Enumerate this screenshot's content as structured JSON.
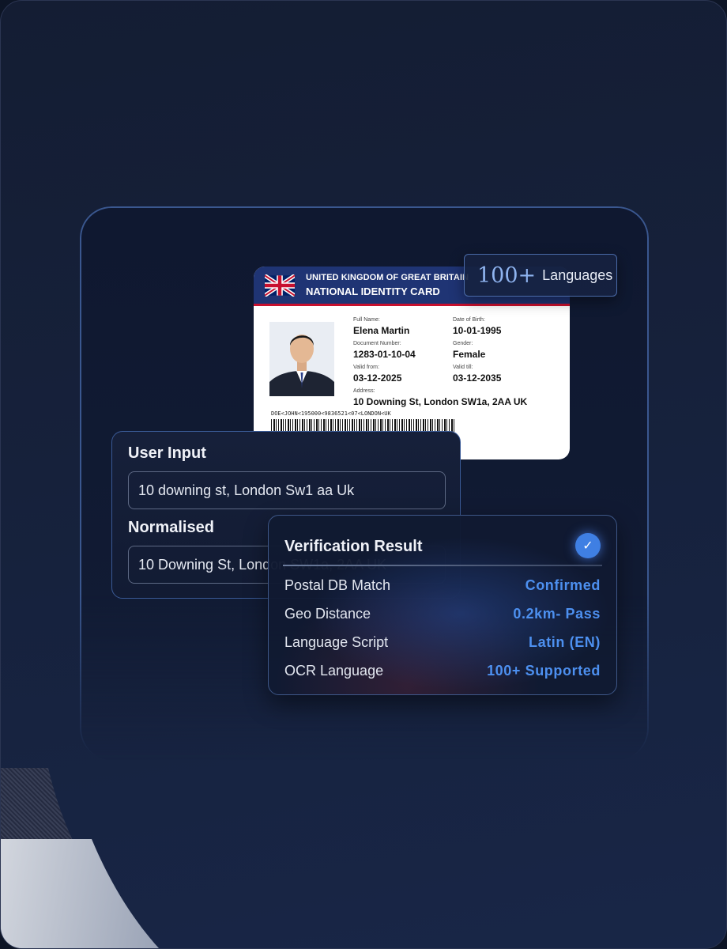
{
  "id_card": {
    "country": "UNITED KINGDOM OF GREAT BRITAIN",
    "card_type": "NATIONAL IDENTITY CARD",
    "fields": [
      {
        "label": "Full Name:",
        "value": "Elena Martin"
      },
      {
        "label": "Date of Birth:",
        "value": "10-01-1995"
      },
      {
        "label": "Document Number:",
        "value": "1283-01-10-04"
      },
      {
        "label": "Gender:",
        "value": "Female"
      },
      {
        "label": "Valid from:",
        "value": "03-12-2025"
      },
      {
        "label": "Valid till:",
        "value": "03-12-2035"
      },
      {
        "label": "Address:",
        "value": "10 Downing St, London SW1a, 2AA UK"
      }
    ],
    "mrz": "DOE<JOHN<195000<9836521<07<LONDON<UK"
  },
  "languages_badge": {
    "number": "100+",
    "label": "Languages"
  },
  "user_input": {
    "title": "User Input",
    "value": "10 downing st, London Sw1 aa Uk",
    "normalised_title": "Normalised",
    "normalised_value": "10 Downing St, London SW1a, 2AA UK"
  },
  "verification": {
    "title": "Verification Result",
    "rows": [
      {
        "key": "Postal DB Match",
        "value": "Confirmed"
      },
      {
        "key": "Geo Distance",
        "value": "0.2km- Pass"
      },
      {
        "key": "Language Script",
        "value": "Latin (EN)"
      },
      {
        "key": "OCR Language",
        "value": "100+ Supported"
      }
    ]
  },
  "colors": {
    "accent": "#4d90f0",
    "card_header": "#1f3474",
    "card_stripe": "#c8102e"
  }
}
